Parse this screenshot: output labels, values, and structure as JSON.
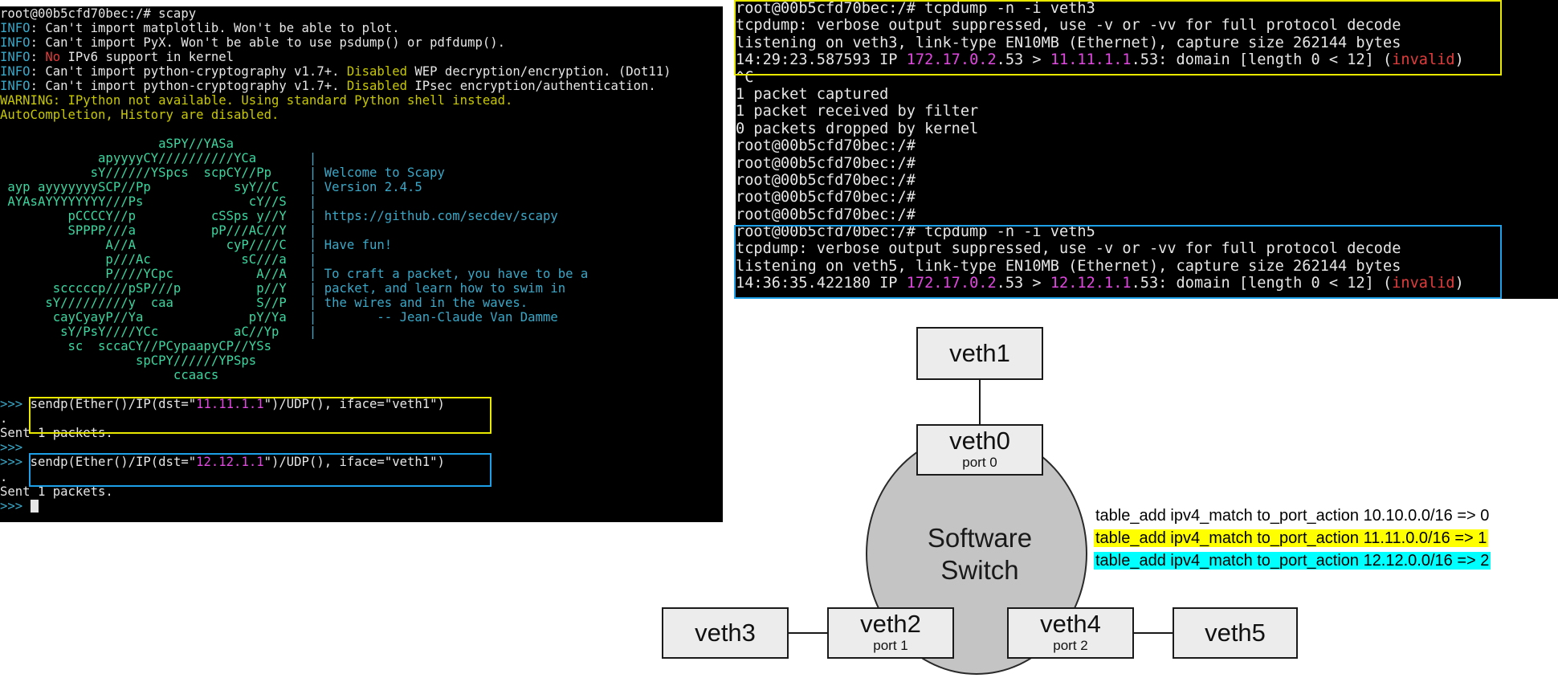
{
  "left_terminal": {
    "lines": [
      [
        {
          "t": "root@00b5cfd70bec:/# scapy",
          "c": ""
        }
      ],
      [
        {
          "t": "INFO",
          "c": "info"
        },
        {
          "t": ": Can't import matplotlib. Won't be able to plot.",
          "c": ""
        }
      ],
      [
        {
          "t": "INFO",
          "c": "info"
        },
        {
          "t": ": Can't import PyX. Won't be able to use psdump() or pdfdump().",
          "c": ""
        }
      ],
      [
        {
          "t": "INFO",
          "c": "info"
        },
        {
          "t": ": ",
          "c": ""
        },
        {
          "t": "No",
          "c": "red"
        },
        {
          "t": " IPv6 support in kernel",
          "c": ""
        }
      ],
      [
        {
          "t": "INFO",
          "c": "info"
        },
        {
          "t": ": Can't import python-cryptography v1.7+. ",
          "c": ""
        },
        {
          "t": "Disabled",
          "c": "warn"
        },
        {
          "t": " WEP decryption/encryption. (Dot11)",
          "c": ""
        }
      ],
      [
        {
          "t": "INFO",
          "c": "info"
        },
        {
          "t": ": Can't import python-cryptography v1.7+. ",
          "c": ""
        },
        {
          "t": "Disabled",
          "c": "warn"
        },
        {
          "t": " IPsec encryption/authentication.",
          "c": ""
        }
      ],
      [
        {
          "t": "WARNING: IPython not available. Using standard Python shell instead.",
          "c": "warn"
        }
      ],
      [
        {
          "t": "AutoCompletion, History are disabled.",
          "c": "warn"
        }
      ],
      [
        {
          "t": "",
          "c": ""
        }
      ],
      [
        {
          "t": "                     aSPY//YASa",
          "c": "green"
        }
      ],
      [
        {
          "t": "             apyyyyCY//////////YCa       ",
          "c": "green"
        },
        {
          "t": "|",
          "c": "banner"
        }
      ],
      [
        {
          "t": "            sY//////YSpcs  scpCY//Pp     ",
          "c": "green"
        },
        {
          "t": "| Welcome to Scapy",
          "c": "banner"
        }
      ],
      [
        {
          "t": " ayp ayyyyyyySCP//Pp           syY//C    ",
          "c": "green"
        },
        {
          "t": "| Version 2.4.5",
          "c": "banner"
        }
      ],
      [
        {
          "t": " AYAsAYYYYYYYY///Ps              cY//S   ",
          "c": "green"
        },
        {
          "t": "|",
          "c": "banner"
        }
      ],
      [
        {
          "t": "         pCCCCY//p          cSSps y//Y   ",
          "c": "green"
        },
        {
          "t": "| https://github.com/secdev/scapy",
          "c": "banner"
        }
      ],
      [
        {
          "t": "         SPPPP///a          pP///AC//Y   ",
          "c": "green"
        },
        {
          "t": "|",
          "c": "banner"
        }
      ],
      [
        {
          "t": "              A//A            cyP////C   ",
          "c": "green"
        },
        {
          "t": "| Have fun!",
          "c": "banner"
        }
      ],
      [
        {
          "t": "              p///Ac            sC///a   ",
          "c": "green"
        },
        {
          "t": "|",
          "c": "banner"
        }
      ],
      [
        {
          "t": "              P////YCpc           A//A   ",
          "c": "green"
        },
        {
          "t": "| To craft a packet, you have to be a",
          "c": "banner"
        }
      ],
      [
        {
          "t": "       scccccp///pSP///p          p//Y   ",
          "c": "green"
        },
        {
          "t": "| packet, and learn how to swim in",
          "c": "banner"
        }
      ],
      [
        {
          "t": "      sY/////////y  caa           S//P   ",
          "c": "green"
        },
        {
          "t": "| the wires and in the waves.",
          "c": "banner"
        }
      ],
      [
        {
          "t": "       cayCyayP//Ya              pY/Ya   ",
          "c": "green"
        },
        {
          "t": "|        -- Jean-Claude Van Damme",
          "c": "banner"
        }
      ],
      [
        {
          "t": "        sY/PsY////YCc          aC//Yp    ",
          "c": "green"
        },
        {
          "t": "|",
          "c": "banner"
        }
      ],
      [
        {
          "t": "         sc  sccaCY//PCypaapyCP//YSs",
          "c": "green"
        }
      ],
      [
        {
          "t": "                  spCPY//////YPSps",
          "c": "green"
        }
      ],
      [
        {
          "t": "                       ccaacs",
          "c": "green"
        }
      ],
      [
        {
          "t": "",
          "c": ""
        }
      ],
      [
        {
          "t": ">>> ",
          "c": "prompt"
        },
        {
          "t": "sendp(Ether()/IP(dst=\"",
          "c": ""
        },
        {
          "t": "11.11.1.1",
          "c": "mag"
        },
        {
          "t": "\")/UDP(), iface=\"veth1\")",
          "c": ""
        }
      ],
      [
        {
          "t": ".",
          "c": ""
        }
      ],
      [
        {
          "t": "Sent 1 packets.",
          "c": ""
        }
      ],
      [
        {
          "t": ">>>",
          "c": "prompt"
        }
      ],
      [
        {
          "t": ">>> ",
          "c": "prompt"
        },
        {
          "t": "sendp(Ether()/IP(dst=\"",
          "c": ""
        },
        {
          "t": "12.12.1.1",
          "c": "mag"
        },
        {
          "t": "\")/UDP(), iface=\"veth1\")",
          "c": ""
        }
      ],
      [
        {
          "t": ".",
          "c": ""
        }
      ],
      [
        {
          "t": "Sent 1 packets.",
          "c": ""
        }
      ],
      [
        {
          "t": ">>> ",
          "c": "prompt"
        }
      ]
    ]
  },
  "right_terminal": {
    "lines": [
      [
        {
          "t": "root@00b5cfd70bec:/# tcpdump -n -i veth3",
          "c": ""
        }
      ],
      [
        {
          "t": "tcpdump: verbose output suppressed, use -v or -vv for full protocol decode",
          "c": ""
        }
      ],
      [
        {
          "t": "listening on veth3, link-type EN10MB (Ethernet), capture size 262144 bytes",
          "c": ""
        }
      ],
      [
        {
          "t": "14:29:23.587593 IP ",
          "c": ""
        },
        {
          "t": "172.17.0.2",
          "c": "mag"
        },
        {
          "t": ".53 > ",
          "c": ""
        },
        {
          "t": "11.11.1.1",
          "c": "mag"
        },
        {
          "t": ".53: domain [length 0 < 12] (",
          "c": ""
        },
        {
          "t": "invalid",
          "c": "red"
        },
        {
          "t": ")",
          "c": ""
        }
      ],
      [
        {
          "t": "^C",
          "c": ""
        }
      ],
      [
        {
          "t": "1 packet captured",
          "c": ""
        }
      ],
      [
        {
          "t": "1 packet received by filter",
          "c": ""
        }
      ],
      [
        {
          "t": "0 packets dropped by kernel",
          "c": ""
        }
      ],
      [
        {
          "t": "root@00b5cfd70bec:/#",
          "c": ""
        }
      ],
      [
        {
          "t": "root@00b5cfd70bec:/#",
          "c": ""
        }
      ],
      [
        {
          "t": "root@00b5cfd70bec:/#",
          "c": ""
        }
      ],
      [
        {
          "t": "root@00b5cfd70bec:/#",
          "c": ""
        }
      ],
      [
        {
          "t": "root@00b5cfd70bec:/#",
          "c": ""
        }
      ],
      [
        {
          "t": "root@00b5cfd70bec:/# tcpdump -n -i veth5",
          "c": ""
        }
      ],
      [
        {
          "t": "tcpdump: verbose output suppressed, use -v or -vv for full protocol decode",
          "c": ""
        }
      ],
      [
        {
          "t": "listening on veth5, link-type EN10MB (Ethernet), capture size 262144 bytes",
          "c": ""
        }
      ],
      [
        {
          "t": "14:36:35.422180 IP ",
          "c": ""
        },
        {
          "t": "172.17.0.2",
          "c": "mag"
        },
        {
          "t": ".53 > ",
          "c": ""
        },
        {
          "t": "12.12.1.1",
          "c": "mag"
        },
        {
          "t": ".53: domain [length 0 < 12] (",
          "c": ""
        },
        {
          "t": "invalid",
          "c": "red"
        },
        {
          "t": ")",
          "c": ""
        }
      ]
    ]
  },
  "diagram": {
    "veth1": {
      "name": "veth1"
    },
    "veth0": {
      "name": "veth0",
      "port": "port 0"
    },
    "switch": {
      "line1": "Software",
      "line2": "Switch"
    },
    "veth2": {
      "name": "veth2",
      "port": "port 1"
    },
    "veth3": {
      "name": "veth3"
    },
    "veth4": {
      "name": "veth4",
      "port": "port 2"
    },
    "veth5": {
      "name": "veth5"
    }
  },
  "table_rules": [
    "table_add ipv4_match to_port_action 10.10.0.0/16 => 0",
    "table_add ipv4_match to_port_action 11.11.0.0/16 => 1",
    "table_add ipv4_match to_port_action 12.12.0.0/16 => 2"
  ],
  "colors": {
    "highlight_yellow": "#ffff00",
    "highlight_cyan": "#00ffff",
    "box_yellow": "#e8e800",
    "box_blue": "#1ea0e8"
  }
}
